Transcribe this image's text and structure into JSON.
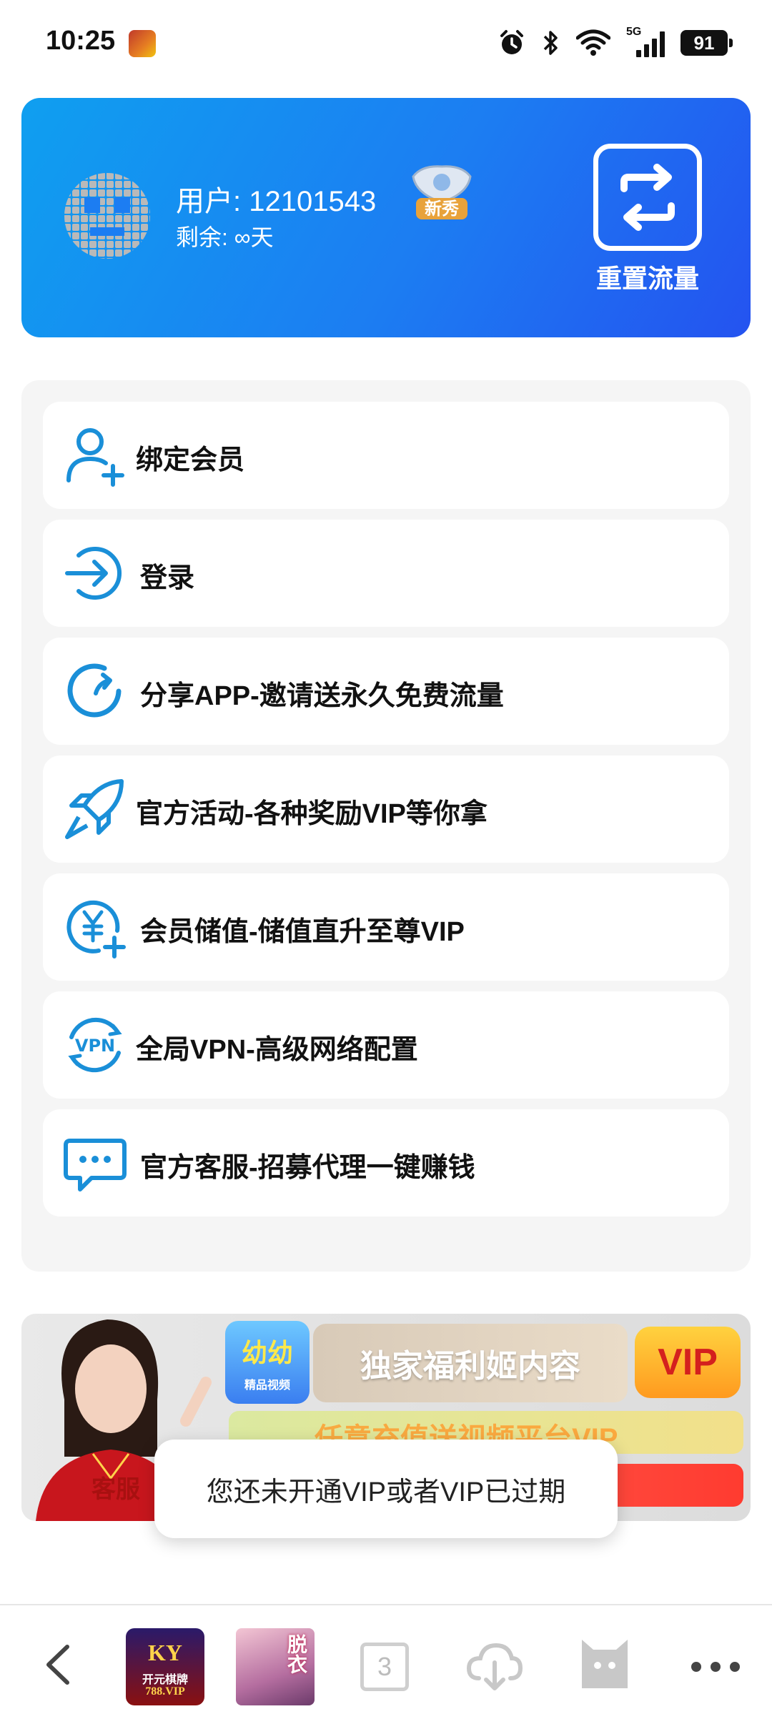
{
  "status_bar": {
    "time": "10:25",
    "network": "5G",
    "battery": "91",
    "icons": [
      "game-notification-icon",
      "alarm-icon",
      "bluetooth-icon",
      "wifi-icon",
      "signal-5g-icon",
      "battery-icon"
    ]
  },
  "header": {
    "user_label": "用户: 12101543",
    "remaining_label": "剩余: ∞天",
    "badge_text": "新秀",
    "reset_label": "重置流量",
    "colors": {
      "gradient_start": "#0f9ff0",
      "gradient_end": "#2453f0"
    }
  },
  "menu": {
    "items": [
      {
        "label": "绑定会员",
        "icon": "add-user-icon"
      },
      {
        "label": "登录",
        "icon": "login-arrow-icon"
      },
      {
        "label": "分享APP-邀请送永久免费流量",
        "icon": "share-refresh-icon"
      },
      {
        "label": "官方活动-各种奖励VIP等你拿",
        "icon": "rocket-icon"
      },
      {
        "label": "会员储值-储值直升至尊VIP",
        "icon": "yuan-recharge-icon"
      },
      {
        "label": "全局VPN-高级网络配置",
        "icon": "vpn-icon"
      },
      {
        "label": "官方客服-招募代理一键赚钱",
        "icon": "chat-bubble-icon"
      }
    ],
    "accent_color": "#1a8fd8"
  },
  "banner": {
    "logo_text": "幼幼",
    "logo_subtext": "精品视频",
    "slogan": "独家福利姬内容",
    "vip_text": "VIP",
    "row2_text": "任意充值送视频平台VIP",
    "service_text": "客服"
  },
  "toast": {
    "message": "您还未开通VIP或者VIP已过期"
  },
  "bottom_nav": {
    "game1_logo": "KY",
    "game1_name": "开元棋牌",
    "game1_site": "788.VIP",
    "game2_text": "脱衣",
    "tabs_count": "3",
    "icons": [
      "back-icon",
      "cloud-download-icon",
      "cat-icon",
      "more-icon"
    ]
  }
}
